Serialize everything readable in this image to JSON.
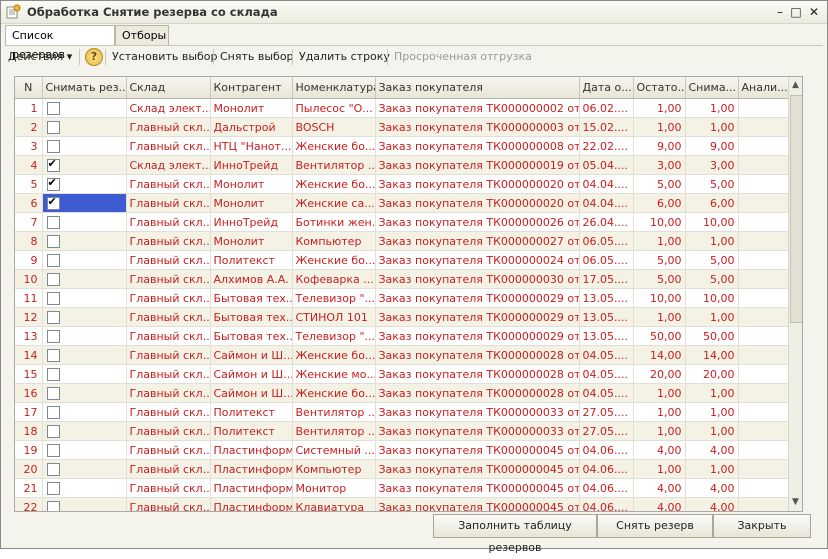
{
  "window": {
    "title": "Обработка  Снятие резерва со склада",
    "controls": [
      "–",
      "□",
      "✕"
    ]
  },
  "tabs": [
    {
      "label": "Список резервов",
      "active": true
    },
    {
      "label": "Отборы",
      "active": false
    }
  ],
  "toolbar": {
    "actions_label": "Действия",
    "help_label": "?",
    "set_selection_label": "Установить выбор",
    "clear_selection_label": "Снять выбор",
    "delete_row_label": "Удалить строку",
    "overdue_label": "Просроченная отгрузка"
  },
  "grid": {
    "columns": [
      "N",
      "Снимать рез...",
      "Склад",
      "Контрагент",
      "Номенклатура",
      "Заказ покупателя",
      "Дата о...",
      "Остато...",
      "Снима...",
      "Анали..."
    ],
    "rows": [
      {
        "n": "1",
        "checked": false,
        "warehouse": "Склад элект...",
        "counterparty": "Монолит",
        "item": "Пылесос \"О...",
        "order": "Заказ покупателя ТК000000002 от ...",
        "date": "06.02....",
        "balance": "1,00",
        "remove": "1,00"
      },
      {
        "n": "2",
        "checked": false,
        "warehouse": "Главный скл...",
        "counterparty": "Дальстрой",
        "item": "BOSCH",
        "order": "Заказ покупателя ТК000000003 от ...",
        "date": "15.02....",
        "balance": "1,00",
        "remove": "1,00"
      },
      {
        "n": "3",
        "checked": false,
        "warehouse": "Главный скл...",
        "counterparty": "НТЦ \"Нанот...",
        "item": "Женские бо...",
        "order": "Заказ покупателя ТК000000008 от ...",
        "date": "22.02....",
        "balance": "9,00",
        "remove": "9,00"
      },
      {
        "n": "4",
        "checked": true,
        "warehouse": "Склад элект...",
        "counterparty": "ИнноТрейд",
        "item": "Вентилятор ...",
        "order": "Заказ покупателя ТК000000019 от ...",
        "date": "05.04....",
        "balance": "3,00",
        "remove": "3,00"
      },
      {
        "n": "5",
        "checked": true,
        "warehouse": "Главный скл...",
        "counterparty": "Монолит",
        "item": "Женские бо...",
        "order": "Заказ покупателя ТК000000020 от ...",
        "date": "04.04....",
        "balance": "5,00",
        "remove": "5,00"
      },
      {
        "n": "6",
        "checked": true,
        "warehouse": "Главный скл...",
        "counterparty": "Монолит",
        "item": "Женские са...",
        "order": "Заказ покупателя ТК000000020 от ...",
        "date": "04.04....",
        "balance": "6,00",
        "remove": "6,00"
      },
      {
        "n": "7",
        "checked": false,
        "warehouse": "Главный скл...",
        "counterparty": "ИнноТрейд",
        "item": "Ботинки жен...",
        "order": "Заказ покупателя ТК000000026 от ...",
        "date": "26.04....",
        "balance": "10,00",
        "remove": "10,00"
      },
      {
        "n": "8",
        "checked": false,
        "warehouse": "Главный скл...",
        "counterparty": "Монолит",
        "item": "Компьютер",
        "order": "Заказ покупателя ТК000000027 от ...",
        "date": "06.05....",
        "balance": "1,00",
        "remove": "1,00"
      },
      {
        "n": "9",
        "checked": false,
        "warehouse": "Главный скл...",
        "counterparty": "Политекст",
        "item": "Женские бо...",
        "order": "Заказ покупателя ТК000000024 от ...",
        "date": "06.05....",
        "balance": "5,00",
        "remove": "5,00"
      },
      {
        "n": "10",
        "checked": false,
        "warehouse": "Главный скл...",
        "counterparty": "Алхимов А.А.",
        "item": "Кофеварка ...",
        "order": "Заказ покупателя ТК000000030 от ...",
        "date": "17.05....",
        "balance": "5,00",
        "remove": "5,00"
      },
      {
        "n": "11",
        "checked": false,
        "warehouse": "Главный скл...",
        "counterparty": "Бытовая тех...",
        "item": "Телевизор \"...",
        "order": "Заказ покупателя ТК000000029 от ...",
        "date": "13.05....",
        "balance": "10,00",
        "remove": "10,00"
      },
      {
        "n": "12",
        "checked": false,
        "warehouse": "Главный скл...",
        "counterparty": "Бытовая тех...",
        "item": "СТИНОЛ 101",
        "order": "Заказ покупателя ТК000000029 от ...",
        "date": "13.05....",
        "balance": "1,00",
        "remove": "1,00"
      },
      {
        "n": "13",
        "checked": false,
        "warehouse": "Главный скл...",
        "counterparty": "Бытовая тех...",
        "item": "Телевизор \"...",
        "order": "Заказ покупателя ТК000000029 от ...",
        "date": "13.05....",
        "balance": "50,00",
        "remove": "50,00"
      },
      {
        "n": "14",
        "checked": false,
        "warehouse": "Главный скл...",
        "counterparty": "Саймон и Ш...",
        "item": "Женские бо...",
        "order": "Заказ покупателя ТК000000028 от ...",
        "date": "04.05....",
        "balance": "14,00",
        "remove": "14,00"
      },
      {
        "n": "15",
        "checked": false,
        "warehouse": "Главный скл...",
        "counterparty": "Саймон и Ш...",
        "item": "Женские мо...",
        "order": "Заказ покупателя ТК000000028 от ...",
        "date": "04.05....",
        "balance": "20,00",
        "remove": "20,00"
      },
      {
        "n": "16",
        "checked": false,
        "warehouse": "Главный скл...",
        "counterparty": "Саймон и Ш...",
        "item": "Женские бо...",
        "order": "Заказ покупателя ТК000000028 от ...",
        "date": "04.05....",
        "balance": "1,00",
        "remove": "1,00"
      },
      {
        "n": "17",
        "checked": false,
        "warehouse": "Главный скл...",
        "counterparty": "Политекст",
        "item": "Вентилятор ...",
        "order": "Заказ покупателя ТК000000033 от ...",
        "date": "27.05....",
        "balance": "1,00",
        "remove": "1,00"
      },
      {
        "n": "18",
        "checked": false,
        "warehouse": "Главный скл...",
        "counterparty": "Политекст",
        "item": "Вентилятор ...",
        "order": "Заказ покупателя ТК000000033 от ...",
        "date": "27.05....",
        "balance": "1,00",
        "remove": "1,00"
      },
      {
        "n": "19",
        "checked": false,
        "warehouse": "Главный скл...",
        "counterparty": "Пластинформ",
        "item": "Системный ...",
        "order": "Заказ покупателя ТК000000045 от ...",
        "date": "04.06....",
        "balance": "4,00",
        "remove": "4,00"
      },
      {
        "n": "20",
        "checked": false,
        "warehouse": "Главный скл...",
        "counterparty": "Пластинформ",
        "item": "Компьютер",
        "order": "Заказ покупателя ТК000000045 от ...",
        "date": "04.06....",
        "balance": "1,00",
        "remove": "1,00"
      },
      {
        "n": "21",
        "checked": false,
        "warehouse": "Главный скл...",
        "counterparty": "Пластинформ",
        "item": "Монитор",
        "order": "Заказ покупателя ТК000000045 от ...",
        "date": "04.06....",
        "balance": "4,00",
        "remove": "4,00"
      },
      {
        "n": "22",
        "checked": false,
        "warehouse": "Главный скл...",
        "counterparty": "Пластинформ",
        "item": "Клавиатура",
        "order": "Заказ покупателя ТК000000045 от ...",
        "date": "04.06....",
        "balance": "4,00",
        "remove": "4,00"
      }
    ],
    "selected_row_index": 5
  },
  "footer": {
    "fill_table_label": "Заполнить таблицу резервов",
    "remove_reserve_label": "Снять резерв",
    "close_label": "Закрыть"
  },
  "colors": {
    "row_text": "#c81e1e",
    "selection": "#3f5bd2",
    "alt_row": "#f4f2e4"
  }
}
